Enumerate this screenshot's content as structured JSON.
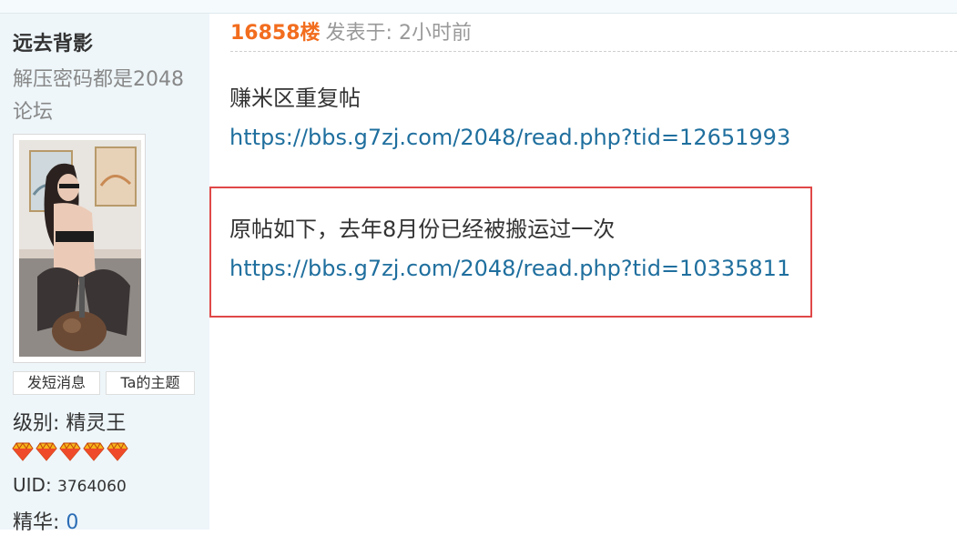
{
  "user": {
    "name": "远去背影",
    "signature": "解压密码都是2048论坛",
    "buttons": {
      "message": "发短消息",
      "topics": "Ta的主题"
    },
    "level_label": "级别: 精灵王",
    "level_icon": "diamond-icon",
    "level_icon_count": 5,
    "uid_label": "UID: ",
    "uid_value": "3764060",
    "essence_label": "精华: ",
    "essence_value": "0"
  },
  "post": {
    "floor": "16858楼",
    "posted": "发表于: 2小时前",
    "line1": "赚米区重复帖",
    "link1": "https://bbs.g7zj.com/2048/read.php?tid=12651993",
    "line2": "原帖如下，去年8月份已经被搬运过一次",
    "link2": "https://bbs.g7zj.com/2048/read.php?tid=10335811"
  },
  "colors": {
    "floor": "#f26d1e",
    "link": "#1f6f9e",
    "highlight_border": "#e04848",
    "sidebar_bg": "#eef6fa"
  }
}
